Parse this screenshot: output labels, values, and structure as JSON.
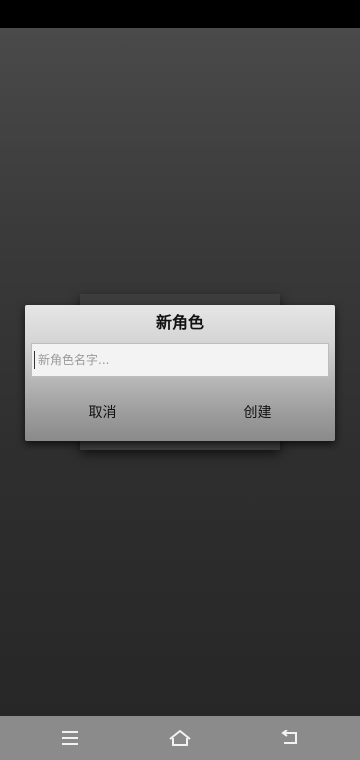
{
  "dialog": {
    "title": "新角色",
    "name_input": {
      "placeholder": "新角色名字...",
      "value": ""
    },
    "cancel_label": "取消",
    "create_label": "创建"
  },
  "nav_bar": {
    "menu_icon": "menu-icon",
    "home_icon": "home-icon",
    "back_icon": "back-icon"
  },
  "colors": {
    "status_bar": "#000000",
    "background_top": "#4a4a4a",
    "background_bottom": "#272727",
    "dialog_top": "#e6e6e6",
    "dialog_bottom": "#8a8a8a",
    "nav_bar": "#8b8b8b"
  }
}
